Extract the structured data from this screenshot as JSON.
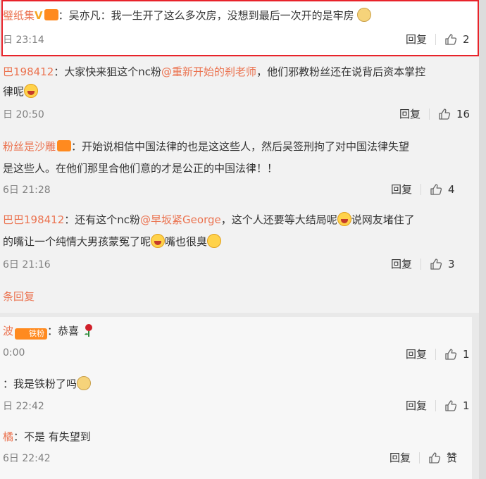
{
  "comments": [
    {
      "user": "璧纸集",
      "vip_mark": "V",
      "sep": "：",
      "text": "吴亦凡：我一生开了这么多次房，没想到最后一次开的是牢房",
      "emoji": "dog-face-emoji",
      "time": "日 23:14",
      "reply": "回复",
      "likes": "2"
    },
    {
      "user": "巴198412",
      "sep": "：",
      "text_a": "大家快来狙这个nc粉",
      "mention": "@重新开始的刹老师",
      "text_b": "，他们邪教粉丝还在说背后资本掌控",
      "line2": "律呢",
      "emoji": "laughing-emoji",
      "time": "日 20:50",
      "reply": "回复",
      "likes": "16"
    },
    {
      "user": "粉丝是沙雕",
      "sep": "：",
      "text": "开始说相信中国法律的也是这这些人，然后吴签刑拘了对中国法律失望",
      "line2": "是这些人。在他们那里合他们意的才是公正的中国法律！！",
      "time": "6日 21:28",
      "reply": "回复",
      "likes": "4"
    },
    {
      "user": "巴巴198412",
      "sep": "：",
      "text_a": "还有这个nc粉",
      "mention": "@早坂紧George",
      "text_b": "，这个人还要等大结局呢",
      "text_c": "说网友堵住了",
      "line2_a": "的嘴让一个纯情大男孩蒙冤了呢",
      "line2_b": "嘴也很臭",
      "time": "6日 21:16",
      "reply": "回复",
      "likes": "3"
    }
  ],
  "more_replies": "条回复",
  "replies": [
    {
      "user": "波",
      "badge": "铁粉",
      "sep": "：",
      "text": "恭喜",
      "time": "0:00",
      "reply": "回复",
      "likes": "1"
    },
    {
      "sep": "：",
      "text": "我是铁粉了吗",
      "time": "日 22:42",
      "reply": "回复",
      "likes": "1"
    },
    {
      "user": "橘",
      "sep": "：",
      "text": "不是 有失望到",
      "time": "6日 22:42",
      "reply": "回复",
      "likes": "赞"
    }
  ],
  "colors": {
    "highlight_border": "#e8232a",
    "username": "#eb7350"
  }
}
